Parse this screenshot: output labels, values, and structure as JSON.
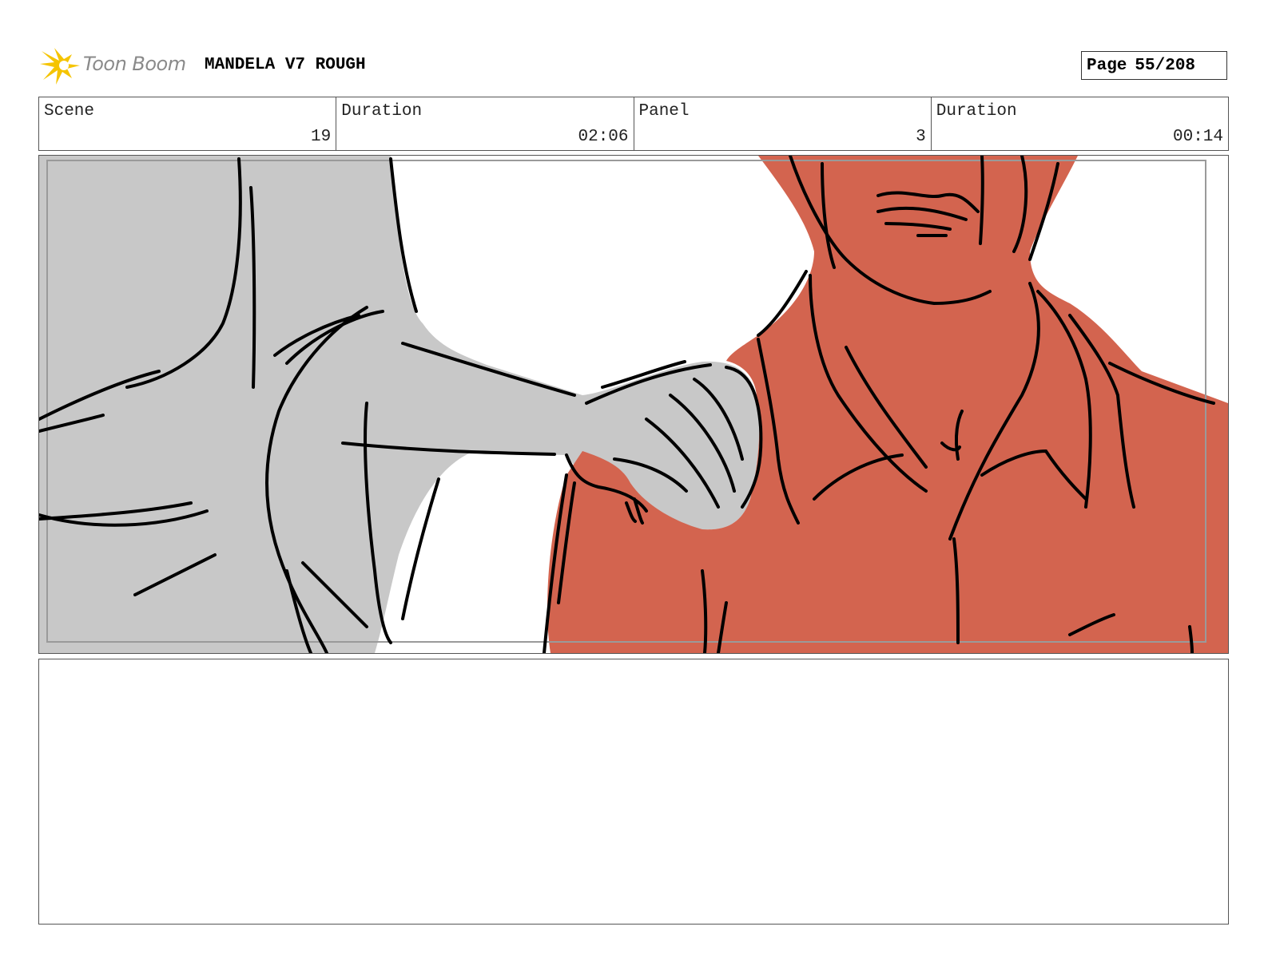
{
  "header": {
    "logo_text": "Toon Boom",
    "project_title": "MANDELA V7 ROUGH",
    "page_label": "Page",
    "page_value": "55/208"
  },
  "info": {
    "scene_label": "Scene",
    "scene_value": "19",
    "scene_duration_label": "Duration",
    "scene_duration_value": "02:06",
    "panel_label": "Panel",
    "panel_value": "3",
    "panel_duration_label": "Duration",
    "panel_duration_value": "00:14"
  },
  "colors": {
    "gray_figure": "#c8c8c8",
    "red_figure": "#d3644f",
    "ink": "#000000",
    "logo_yellow": "#f5c400"
  },
  "notes": {
    "text": ""
  }
}
